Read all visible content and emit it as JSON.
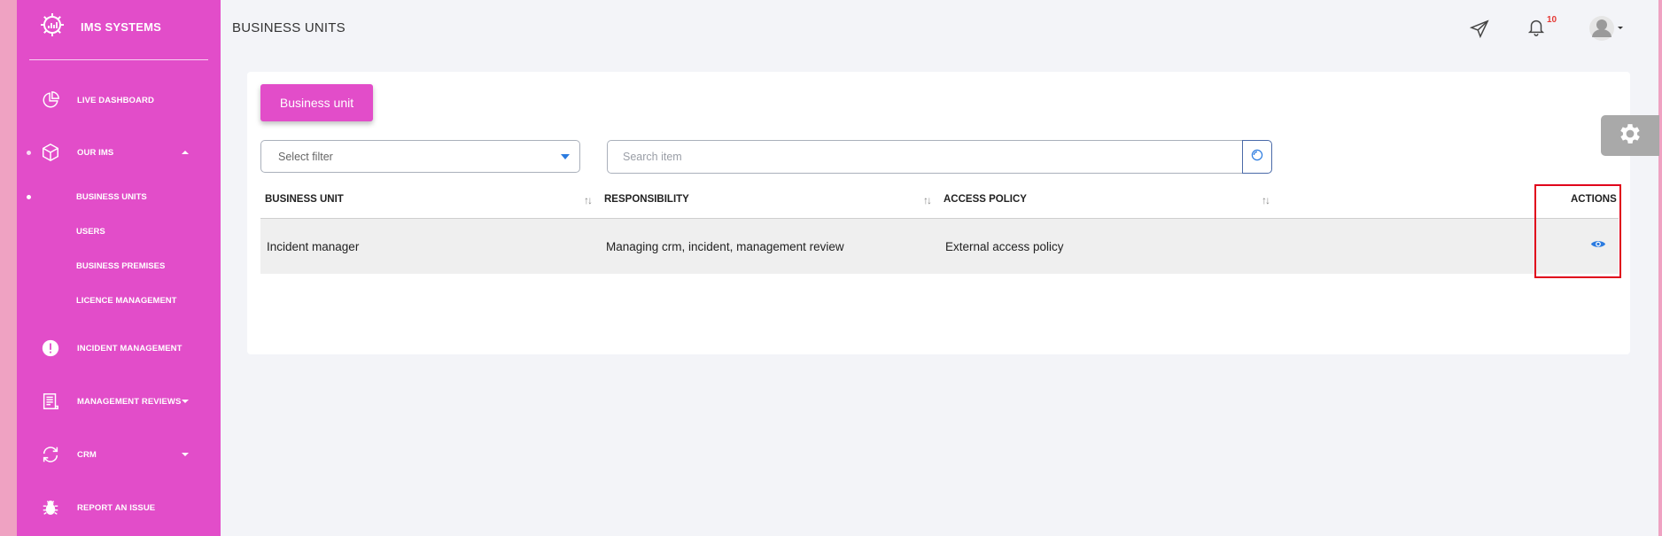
{
  "brand": {
    "name": "IMS SYSTEMS"
  },
  "sidebar": {
    "items": [
      {
        "label": "LIVE DASHBOARD",
        "icon": "pie-chart-icon"
      },
      {
        "label": "OUR IMS",
        "icon": "cube-icon",
        "expanded": true
      },
      {
        "label": "INCIDENT MANAGEMENT",
        "icon": "alert-icon"
      },
      {
        "label": "MANAGEMENT REVIEWS",
        "icon": "document-icon"
      },
      {
        "label": "CRM",
        "icon": "refresh-icon"
      },
      {
        "label": "REPORT AN ISSUE",
        "icon": "bug-icon"
      }
    ],
    "subitems": [
      {
        "label": "BUSINESS UNITS",
        "active": true
      },
      {
        "label": "USERS"
      },
      {
        "label": "BUSINESS PREMISES"
      },
      {
        "label": "LICENCE MANAGEMENT"
      }
    ]
  },
  "header": {
    "title": "BUSINESS UNITS",
    "notification_count": "10",
    "icons": [
      "send-icon",
      "bell-icon",
      "avatar"
    ]
  },
  "toolbar": {
    "add_button": "Business unit",
    "filter_placeholder": "Select filter",
    "search_placeholder": "Search item"
  },
  "table": {
    "columns": [
      "BUSINESS UNIT",
      "RESPONSIBILITY",
      "ACCESS POLICY",
      "ACTIONS"
    ],
    "rows": [
      {
        "business_unit": "Incident manager",
        "responsibility": "Managing crm, incident, management review",
        "access_policy": "External access policy",
        "action_icon": "eye-icon"
      }
    ]
  },
  "colors": {
    "sidebar": "#e24dc9",
    "accent_blue": "#2b7be0",
    "badge_red": "#e53935",
    "highlight_red": "#e0001b"
  }
}
